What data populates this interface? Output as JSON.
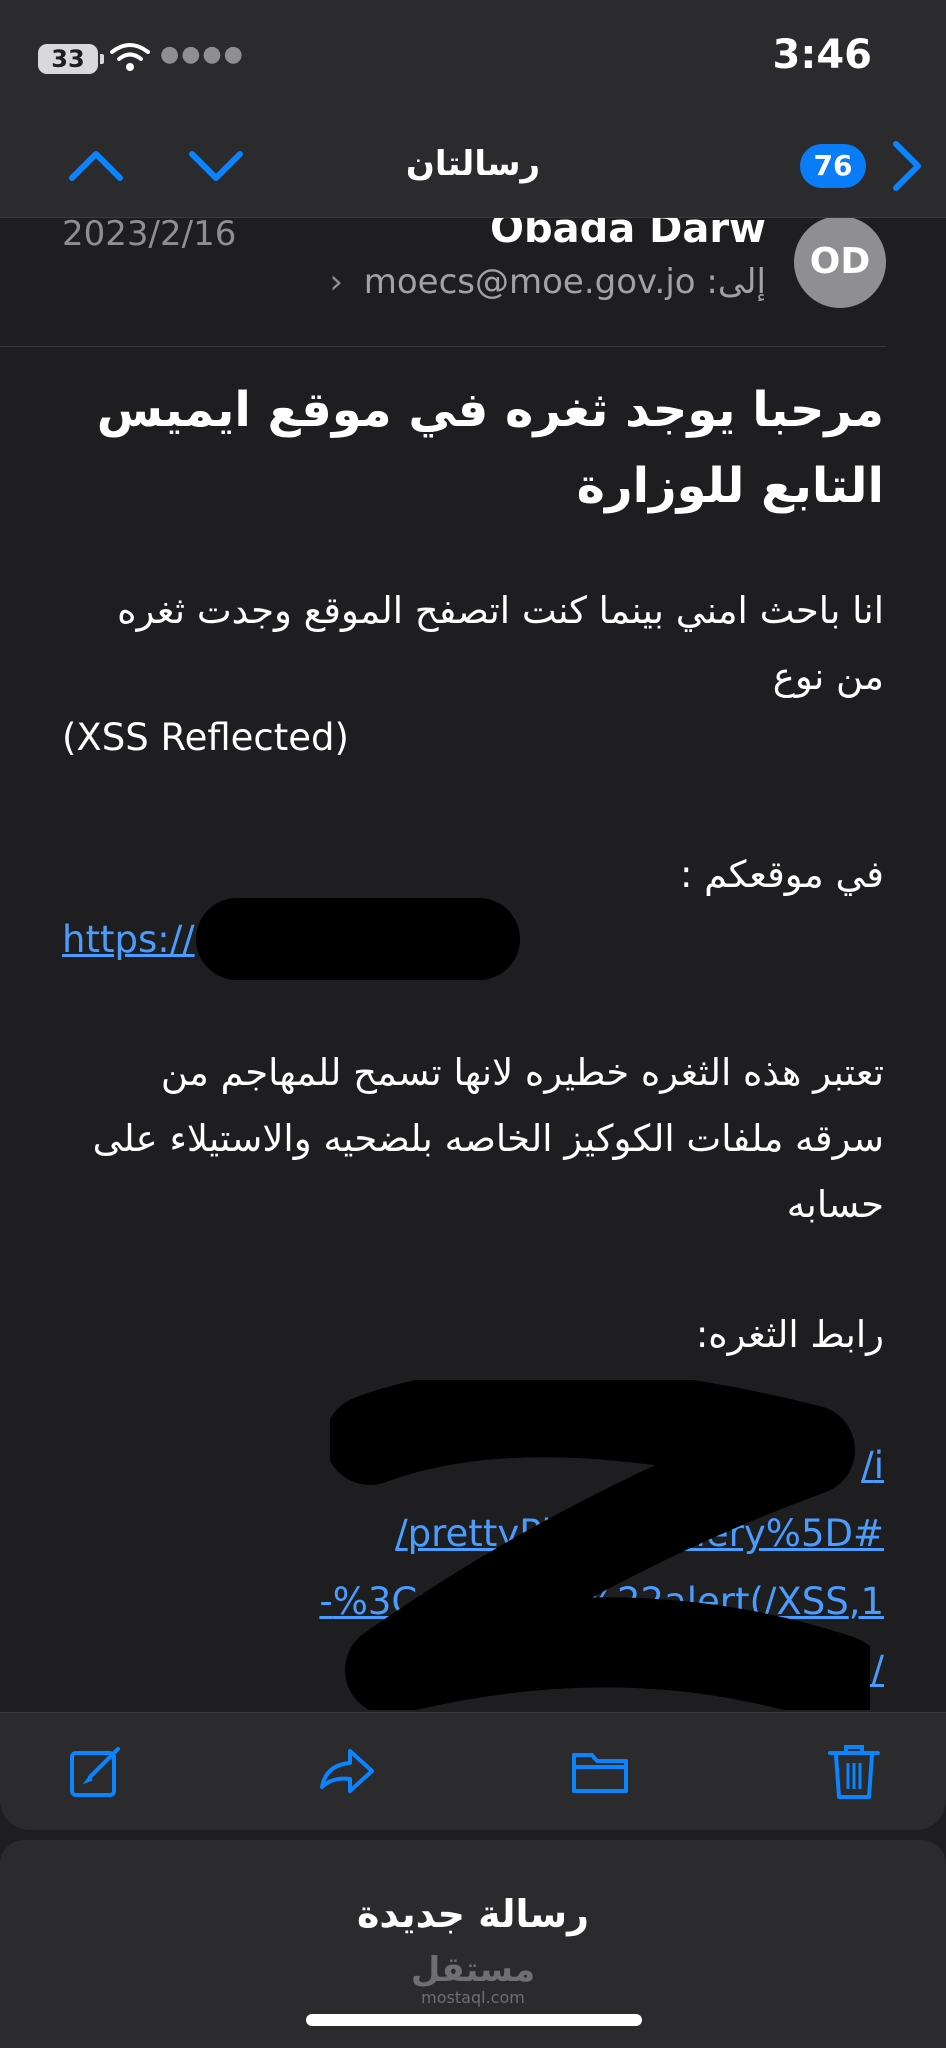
{
  "status_bar": {
    "time": "3:46",
    "battery_level": "33",
    "icons": [
      "battery-icon",
      "wifi-icon",
      "signal-icon"
    ]
  },
  "nav": {
    "title": "رسالتان",
    "unread_count": "76",
    "icons": [
      "chevron-up-icon",
      "chevron-down-icon",
      "chevron-right-icon"
    ]
  },
  "message": {
    "avatar_initials": "OD",
    "sender": "Obada Darw",
    "date": "2023/2/16",
    "to_label": "إلى:",
    "recipient": "moecs@moe.gov.jo",
    "subject": "مرحبا يوجد ثغره في موقع ايميس التابع للوزارة",
    "para1": "انا باحث امني بينما كنت اتصفح الموقع وجدت ثغره من نوع",
    "xss_type": "(XSS Reflected)",
    "site_label": "في موقعكم :",
    "site_link": "https://",
    "para2": "تعتبر هذه الثغره خطيره لانها تسمح للمهاجم من سرقه ملفات الكوكيز الخاصه بلضحيه والاستيلاء على حسابه",
    "vuln_link_label": "رابط الثغره:",
    "vuln_link_lines": [
      "i/",
      "#prettyPhoto[gallery%5D/",
      "1,%3Ca%20o…%22alert(/XSS-",
      "/Re…E"
    ]
  },
  "toolbar": {
    "icons": [
      "compose-icon",
      "reply-icon",
      "folder-icon",
      "trash-icon"
    ]
  },
  "draft": {
    "title": "رسالة جديدة",
    "watermark_main": "مستقل",
    "watermark_sub": "mostaql.com"
  },
  "colors": {
    "background": "#1e1e20",
    "bar": "#2b2b2e",
    "accent": "#0a7cf7",
    "link": "#4a9dff",
    "secondary_text": "#8e8e93"
  }
}
